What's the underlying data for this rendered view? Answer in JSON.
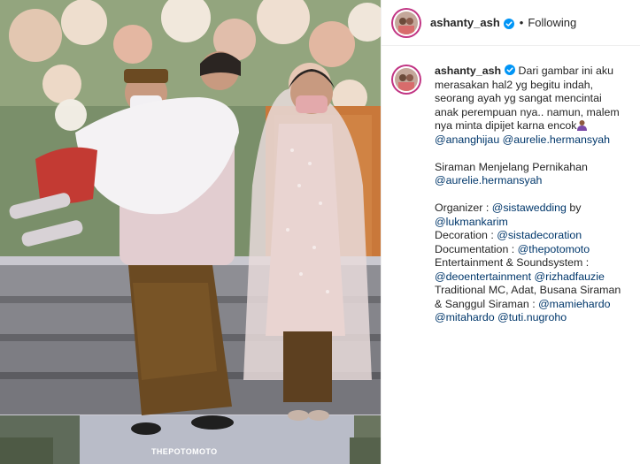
{
  "post": {
    "watermark": "THEPOTOMOTO"
  },
  "header": {
    "username": "ashanty_ash",
    "dot": "•",
    "follow_status": "Following"
  },
  "caption": {
    "username": "ashanty_ash",
    "p1_text_1": "Dari gambar ini aku merasakan hal2 yg begitu indah, seorang ayah yg sangat mencintai anak perempuan nya.. namun, malem nya minta dipijet karna encok",
    "p1_mention_1": "@ananghijau",
    "p1_mention_2": "@aurelie.hermansyah",
    "p2_text": "Siraman Menjelang Pernikahan",
    "p2_mention": "@aurelie.hermansyah",
    "organizer_label": "Organizer : ",
    "organizer_mention_1": "@sistawedding",
    "organizer_by": " by",
    "organizer_mention_2": "@lukmankarim",
    "decoration_label": "Decoration : ",
    "decoration_mention": "@sistadecoration",
    "documentation_label": "Documentation : ",
    "documentation_mention": "@thepotomoto",
    "entertainment_label": "Entertainment & Soundsystem :",
    "entertainment_mention_1": "@deoentertainment",
    "entertainment_mention_2": "@rizhadfauzie",
    "mc_text": "Traditional MC, Adat, Busana Siraman & Sanggul Siraman : ",
    "mc_mention_1": "@mamiehardo",
    "mc_mention_2": "@mitahardo",
    "mc_mention_3": "@tuti.nugroho"
  },
  "icons": {
    "verified": "verified-badge-icon",
    "emoji": "person-shrugging-emoji-icon"
  },
  "colors": {
    "text": "#262626",
    "link": "#00376b",
    "verified": "#0095f6",
    "border": "#efefef",
    "story_ring": "#c13584"
  }
}
